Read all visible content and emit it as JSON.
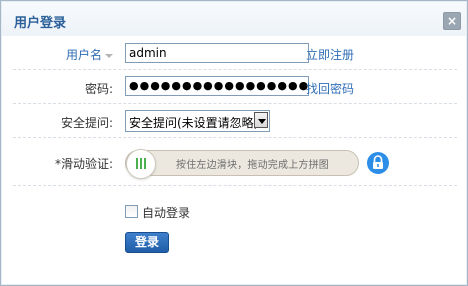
{
  "dialog": {
    "title": "用户登录",
    "close_label": "×"
  },
  "form": {
    "username": {
      "label": "用户名",
      "value": "admin",
      "link": "立即注册"
    },
    "password": {
      "label": "密码:",
      "value": "●●●●●●●●●●●●●●●●●",
      "link": "找回密码"
    },
    "security_question": {
      "label": "安全提问:",
      "selected": "安全提问(未设置请忽略)"
    },
    "captcha": {
      "label": "*滑动验证:",
      "hint": "按住左边滑块，拖动完成上方拼图",
      "progress": 0
    },
    "auto_login": {
      "label": "自动登录",
      "checked": false
    },
    "submit_label": "登录"
  },
  "icons": {
    "close": "close-icon",
    "slider_grip": "grip-icon",
    "lock": "lock-icon",
    "dropdown": "chevron-down-icon"
  },
  "colors": {
    "title": "#2a5f99",
    "link": "#2f6eb5",
    "button": "#1f5ea9",
    "lock": "#2d8ee8",
    "grip": "#4caf50"
  }
}
